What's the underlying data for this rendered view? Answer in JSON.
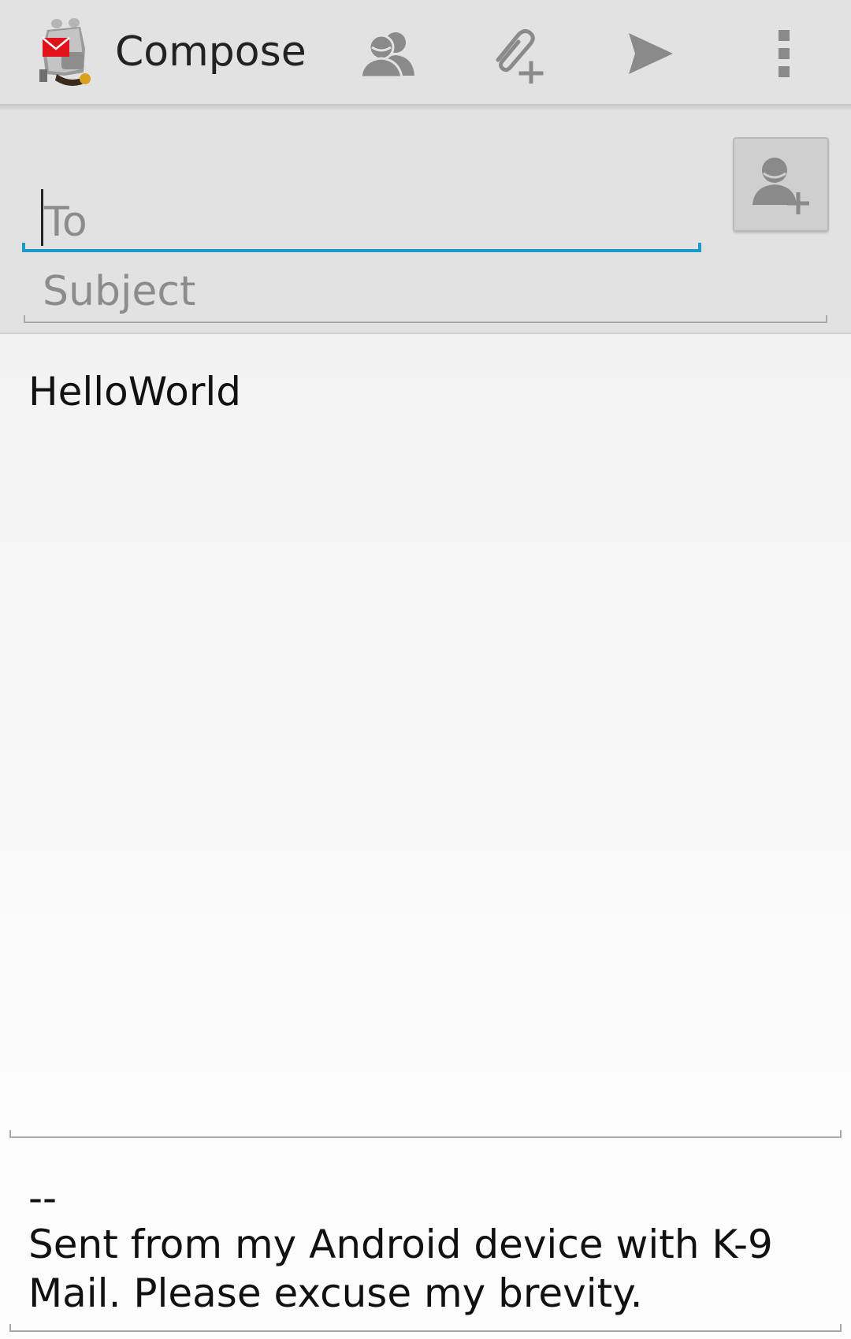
{
  "action_bar": {
    "title": "Compose",
    "app_icon": "k9-mail-dog-icon",
    "actions": [
      {
        "name": "contacts-icon"
      },
      {
        "name": "attach-icon"
      },
      {
        "name": "send-icon"
      },
      {
        "name": "overflow-menu-icon"
      }
    ]
  },
  "header": {
    "to": {
      "placeholder": "To",
      "value": ""
    },
    "add_contact_icon": "add-contact-icon",
    "subject": {
      "placeholder": "Subject",
      "value": ""
    }
  },
  "message": {
    "body": "HelloWorld",
    "signature_separator": "--",
    "signature": "Sent from my Android device with K-9 Mail. Please excuse my brevity."
  },
  "colors": {
    "accent": "#1a9ac9",
    "action_bar": "#e2e2e2",
    "icon": "#8a8a8a"
  }
}
